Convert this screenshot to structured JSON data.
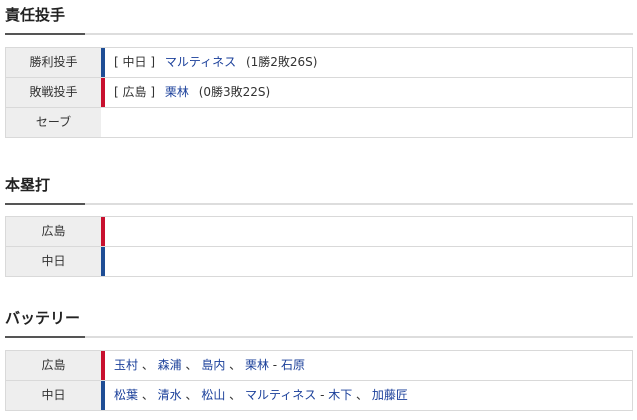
{
  "pitchers": {
    "title": "責任投手",
    "rows": [
      {
        "label": "勝利投手",
        "team": "中日",
        "name": "マルティネス",
        "record": "(1勝2敗26S)"
      },
      {
        "label": "敗戦投手",
        "team": "広島",
        "name": "栗林",
        "record": "(0勝3敗22S)"
      },
      {
        "label": "セーブ"
      }
    ]
  },
  "homeruns": {
    "title": "本塁打",
    "rows": [
      {
        "label": "広島"
      },
      {
        "label": "中日"
      }
    ]
  },
  "battery": {
    "title": "バッテリー",
    "rows": [
      {
        "label": "広島",
        "pitchers": [
          "玉村",
          "森浦",
          "島内",
          "栗林"
        ],
        "catchers": [
          "石原"
        ]
      },
      {
        "label": "中日",
        "pitchers": [
          "松葉",
          "清水",
          "松山",
          "マルティネス"
        ],
        "catchers": [
          "木下",
          "加藤匠"
        ]
      }
    ]
  },
  "colors": {
    "central_blue": "#1e4d95",
    "carp_red": "#c8102e",
    "link": "#1a3f9a"
  }
}
